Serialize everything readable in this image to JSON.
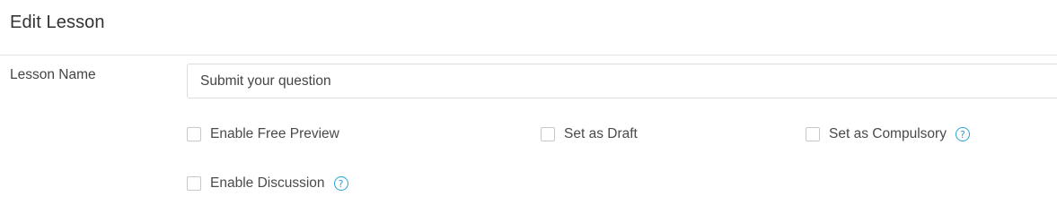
{
  "page": {
    "title": "Edit Lesson"
  },
  "form": {
    "lesson_name": {
      "label": "Lesson Name",
      "value": "Submit your question"
    },
    "options": {
      "enable_free_preview": {
        "label": "Enable Free Preview",
        "checked": false
      },
      "set_as_draft": {
        "label": "Set as Draft",
        "checked": false
      },
      "set_as_compulsory": {
        "label": "Set as Compulsory",
        "checked": false,
        "help_icon": "question-circle-icon"
      },
      "enable_discussion": {
        "label": "Enable Discussion",
        "checked": false,
        "help_icon": "question-circle-icon"
      }
    },
    "help_glyph": "?"
  },
  "colors": {
    "accent": "#2aa3d8",
    "border": "#dcdcdc",
    "divider": "#e3e3e3",
    "text": "#333333"
  }
}
